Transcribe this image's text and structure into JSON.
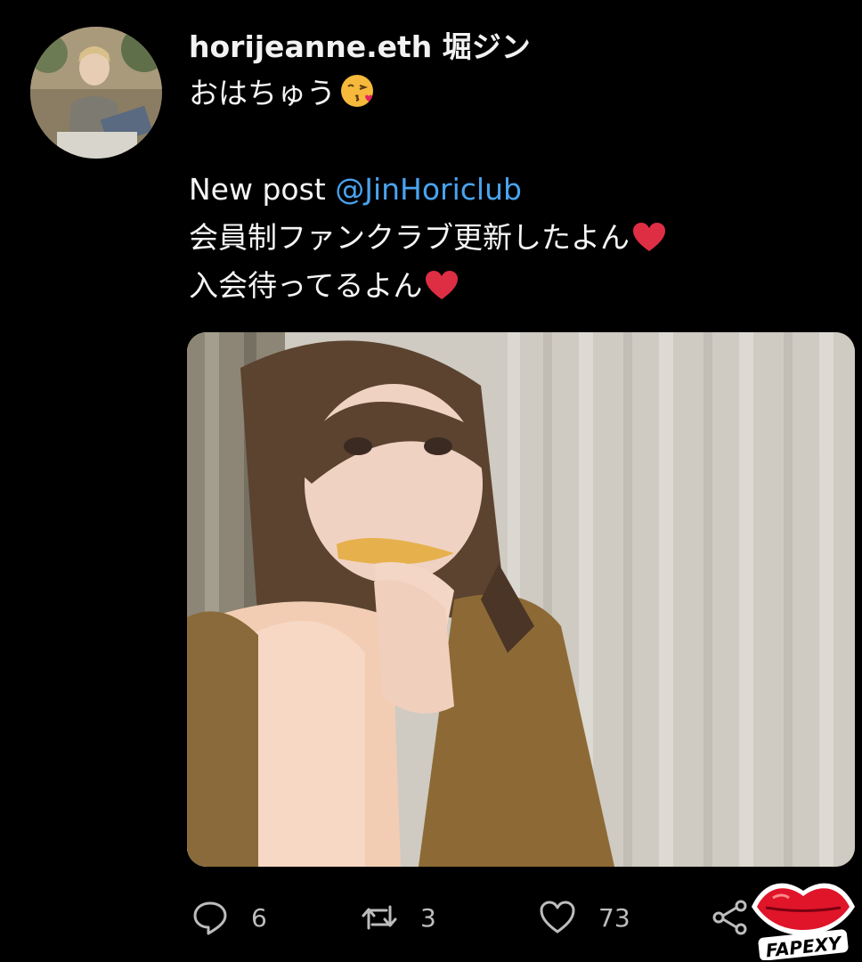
{
  "tweet": {
    "display_name": "horijeanne.eth 堀ジン",
    "line1": "おはちゅう",
    "line1_emoji": "kissing-face-emoji",
    "line2_prefix": "New post ",
    "line2_mention": "@JinHoriclub",
    "line3": "会員制ファンクラブ更新したよん",
    "line4": "入会待ってるよん",
    "heart_icon": "red-heart-icon",
    "mention_color": "#4aa3ee"
  },
  "actions": {
    "reply_count": "6",
    "retweet_count": "3",
    "like_count": "73"
  },
  "watermark": {
    "text": "FAPEXY"
  }
}
